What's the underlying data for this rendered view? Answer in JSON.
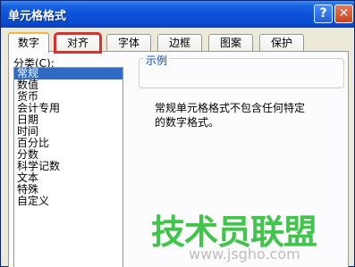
{
  "window": {
    "title": "单元格格式"
  },
  "title_buttons": {
    "help": "?",
    "close": "✕"
  },
  "tabs": [
    {
      "label": "数字",
      "selected": true
    },
    {
      "label": "对齐",
      "highlighted": true
    },
    {
      "label": "字体"
    },
    {
      "label": "边框"
    },
    {
      "label": "图案"
    },
    {
      "label": "保护"
    }
  ],
  "category": {
    "label": "分类(C):",
    "items": [
      "常规",
      "数值",
      "货币",
      "会计专用",
      "日期",
      "时间",
      "百分比",
      "分数",
      "科学记数",
      "文本",
      "特殊",
      "自定义"
    ],
    "selected_index": 0
  },
  "sample": {
    "label": "示例"
  },
  "description": {
    "line1": "常规单元格格式不包含任何特定",
    "line2": "的数字格式。"
  },
  "watermark": {
    "text": "技术员联盟",
    "url": "www.jsgho.com"
  },
  "colors": {
    "title_bar": "#0a4ad0",
    "selected_item": "#316ac5",
    "tab_highlight_outline": "#d9322b",
    "watermark": "#40c44a"
  }
}
